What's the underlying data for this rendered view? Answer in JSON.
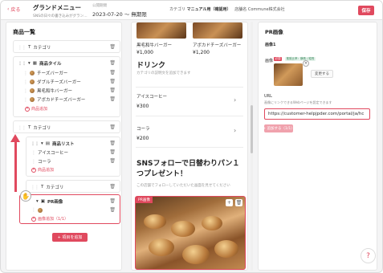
{
  "header": {
    "back_label": "戻る",
    "title": "グランドメニュー",
    "subtitle": "SNSの日々の書き込みがグラン…",
    "period_label": "公開期間",
    "period": "2023-07-20 〜 無期限",
    "category_label": "カテゴリ",
    "category_value": "マニュアル用（確認用）",
    "store_label": "店舗名",
    "store_value": "Commune株式会社",
    "save_label": "保存"
  },
  "left": {
    "title": "商品一覧",
    "category1": "カテゴリ",
    "tile_label": "商品タイル",
    "items": [
      "チーズバーガー",
      "ダブルチーズバーガー",
      "黒毛和牛バーガー",
      "アボカドチーズバーガー"
    ],
    "add_product": "商品追加",
    "category2": "カテゴリ",
    "list_label": "商品リスト",
    "list_items": [
      "アイスコーヒー",
      "コーラ"
    ],
    "add_product2": "商品追加",
    "category3": "カテゴリ",
    "pr_label": "PR画像",
    "add_image": "画像追加（1/1）",
    "add_item": "+ 項目を追加"
  },
  "preview": {
    "top_items": [
      {
        "name": "黒毛和牛バーガー",
        "price": "¥1,000"
      },
      {
        "name": "アボカドチーズバーガー",
        "price": "¥1,200"
      }
    ],
    "drink_title": "ドリンク",
    "drink_desc": "カテゴリの説明文を追加できます",
    "drinks": [
      {
        "name": "アイスコーヒー",
        "price": "¥300"
      },
      {
        "name": "コーラ",
        "price": "¥200"
      }
    ],
    "sns_title": "SNSフォローで日替わりパン１つプレゼント！",
    "sns_desc": "この店舗でフォローしていただいた画面を見せてください",
    "pr_badge": "PR画像"
  },
  "right": {
    "title": "PR画像",
    "image_label": "画像1",
    "image_field": "画像",
    "tag_required": "必須",
    "tag_size": "推奨比率：横長 / 縦長",
    "change_btn": "変更する",
    "url_label": "URL",
    "url_note": "画像にリンクできるWebページを設定できます",
    "url_value": "https://customer-helpjpder.com/portal/ja/hc",
    "add_url": "+ 追加する（1/1）"
  },
  "colors": {
    "accent": "#e0495e"
  }
}
